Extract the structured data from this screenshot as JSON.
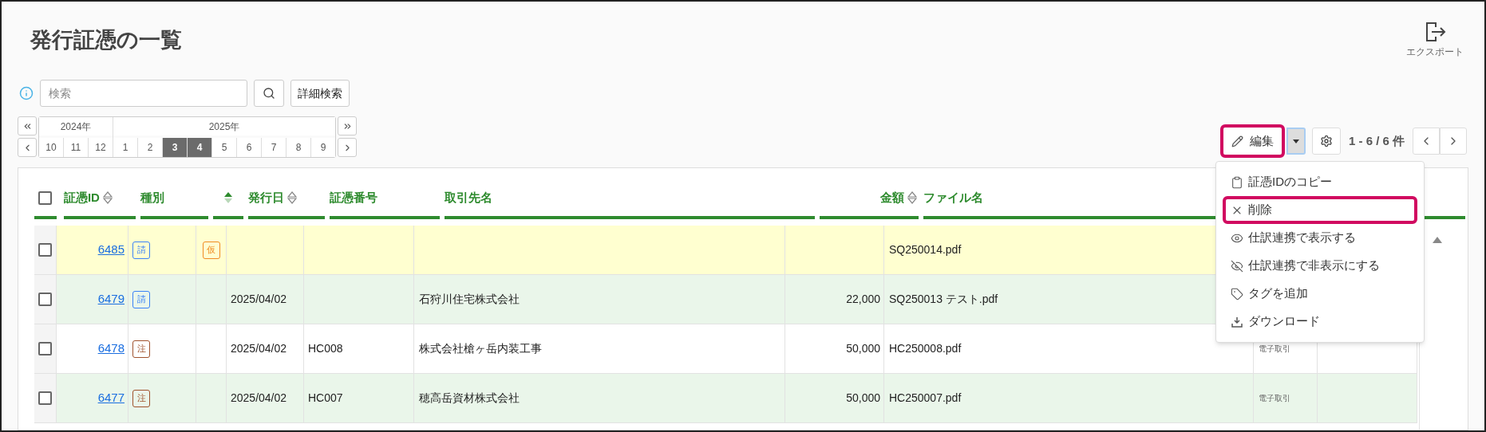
{
  "title": "発行証憑の一覧",
  "export": {
    "label": "エクスポート"
  },
  "search": {
    "placeholder": "検索",
    "advanced_label": "詳細検索"
  },
  "calendar": {
    "years": [
      {
        "label": "2024年",
        "months": [
          {
            "label": "10",
            "selected": false
          },
          {
            "label": "11",
            "selected": false
          },
          {
            "label": "12",
            "selected": false
          }
        ]
      },
      {
        "label": "2025年",
        "months": [
          {
            "label": "1",
            "selected": false
          },
          {
            "label": "2",
            "selected": false
          },
          {
            "label": "3",
            "selected": true
          },
          {
            "label": "4",
            "selected": true
          },
          {
            "label": "5",
            "selected": false
          },
          {
            "label": "6",
            "selected": false
          },
          {
            "label": "7",
            "selected": false
          },
          {
            "label": "8",
            "selected": false
          },
          {
            "label": "9",
            "selected": false
          }
        ]
      }
    ]
  },
  "toolbar": {
    "edit_label": "編集",
    "edit_highlighted": true,
    "count": "1 - 6 / 6 件"
  },
  "menu": {
    "items": [
      {
        "kind": "copy",
        "label": "証憑IDのコピー",
        "highlighted": false
      },
      {
        "kind": "delete",
        "label": "削除",
        "highlighted": true
      },
      {
        "kind": "show",
        "label": "仕訳連携で表示する",
        "highlighted": false
      },
      {
        "kind": "hide",
        "label": "仕訳連携で非表示にする",
        "highlighted": false
      },
      {
        "kind": "tag",
        "label": "タグを追加",
        "highlighted": false
      },
      {
        "kind": "download",
        "label": "ダウンロード",
        "highlighted": false
      }
    ]
  },
  "table": {
    "header_checked": false,
    "columns": [
      {
        "label": "証憑ID",
        "sorted": false
      },
      {
        "label": "種別"
      },
      {
        "sorted": true
      },
      {
        "label": "発行日",
        "sorted": false
      },
      {
        "label": "証憑番号"
      },
      {
        "label": "取引先名"
      },
      {
        "label": "金額",
        "sorted": false
      },
      {
        "label": "ファイル名"
      }
    ],
    "rows": [
      {
        "checked": false,
        "highlighted": true,
        "id": "6485",
        "type": {
          "label": "請",
          "color": "#3b82f6"
        },
        "status": {
          "label": "仮",
          "color": "#f08a24"
        },
        "file": "SQ250014.pdf"
      },
      {
        "checked": false,
        "highlighted": false,
        "id": "6479",
        "type": {
          "label": "請",
          "color": "#3b82f6"
        },
        "date": "2025/04/02",
        "client": "石狩川住宅株式会社",
        "amount": "22,000",
        "file": "SQ250013 テスト.pdf"
      },
      {
        "checked": false,
        "highlighted": false,
        "id": "6478",
        "type": {
          "label": "注",
          "color": "#a0522d"
        },
        "date": "2025/04/02",
        "number": "HC008",
        "client": "株式会社槍ヶ岳内装工事",
        "amount": "50,000",
        "file": "HC250008.pdf",
        "column_9": "電子取引"
      },
      {
        "checked": false,
        "highlighted": false,
        "id": "6477",
        "type": {
          "label": "注",
          "color": "#a0522d"
        },
        "date": "2025/04/02",
        "number": "HC007",
        "client": "穂高岳資材株式会社",
        "amount": "50,000",
        "file": "HC250007.pdf",
        "column_9": "電子取引"
      }
    ]
  }
}
